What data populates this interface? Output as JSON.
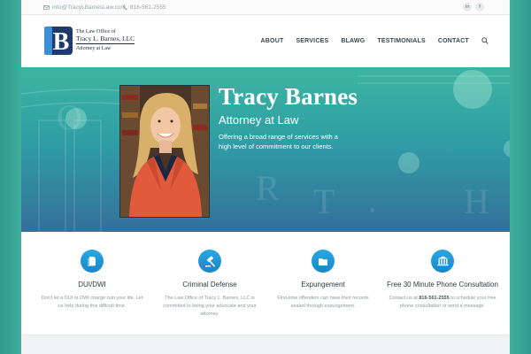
{
  "topbar": {
    "email": "info@TracyLBarnesLaw.com",
    "phone": "816-561-2555",
    "social": [
      {
        "icon": "linkedin-icon",
        "label": "in"
      },
      {
        "icon": "facebook-icon",
        "label": "f"
      }
    ]
  },
  "logo": {
    "monogram": "B",
    "line1": "The Law Office of",
    "line2": "Tracy L. Barnes, LLC",
    "line3": "Attorney at Law"
  },
  "nav": {
    "items": [
      "ABOUT",
      "SERVICES",
      "BLAWG",
      "TESTIMONIALS",
      "CONTACT"
    ],
    "search_icon": "search-icon"
  },
  "hero": {
    "title": "Tracy Barnes",
    "subtitle": "Attorney at Law",
    "description": "Offering a broad range of services with a high level of commitment to our clients."
  },
  "services": [
    {
      "icon": "document-icon",
      "title": "DUI/DWI",
      "desc": "Don't let a DUI or DWI charge ruin your life. Let us help during this difficult time."
    },
    {
      "icon": "gavel-icon",
      "title": "Criminal Defense",
      "desc": "The Law Office of Tracy L. Barnes, LLC is committed to being your advocate and your attorney."
    },
    {
      "icon": "folder-icon",
      "title": "Expungement",
      "desc": "First-time offenders can have their records sealed through expungement."
    },
    {
      "icon": "courthouse-icon",
      "title": "Free 30 Minute Phone Consultation",
      "desc_pre": "Contact us at ",
      "desc_phone": "816-561-2555",
      "desc_post": " to schedule your free phone consultation or send a message."
    }
  ],
  "colors": {
    "accent": "#1a86c8",
    "hero_top": "#3db5a1",
    "hero_bottom": "#356f9a",
    "nav_text": "#3a4650"
  }
}
